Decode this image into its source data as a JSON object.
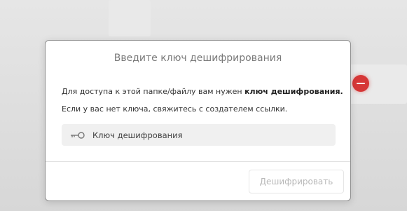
{
  "dialog": {
    "title": "Введите ключ дешифрирования",
    "message_part1": "Для доступа к этой папке/файлу вам нужен ",
    "message_bold": "ключ дешифрования.",
    "message_line2": "Если у вас нет ключа, свяжитесь с создателем ссылки.",
    "key_field": {
      "placeholder": "Ключ дешифрования",
      "value": "",
      "icon": "key-icon"
    },
    "decrypt_button": "Дешифрировать"
  },
  "colors": {
    "overlay": "#dcdcdc",
    "dialog_bg": "#ffffff",
    "field_bg": "#f0f0f0",
    "disabled_text": "#b8b8b8",
    "background_badge": "#d63737"
  }
}
